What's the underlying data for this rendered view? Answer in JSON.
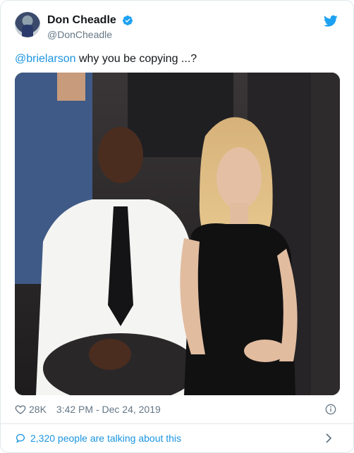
{
  "user": {
    "display_name": "Don Cheadle",
    "handle": "@DonCheadle"
  },
  "tweet": {
    "mention": "@brielarson",
    "text": " why you be copying ...?"
  },
  "meta": {
    "likes": "28K",
    "timestamp": "3:42 PM - Dec 24, 2019"
  },
  "conversation": {
    "label": "2,320 people are talking about this"
  },
  "icons": {
    "verified": "verified-badge-icon",
    "brand": "twitter-bird-icon",
    "like": "heart-icon",
    "info": "info-icon",
    "reply": "speech-bubble-icon",
    "more": "chevron-right-icon"
  },
  "colors": {
    "link": "#1b95e0",
    "muted": "#657786",
    "verified": "#1da1f2",
    "border": "#e1e8ed"
  }
}
